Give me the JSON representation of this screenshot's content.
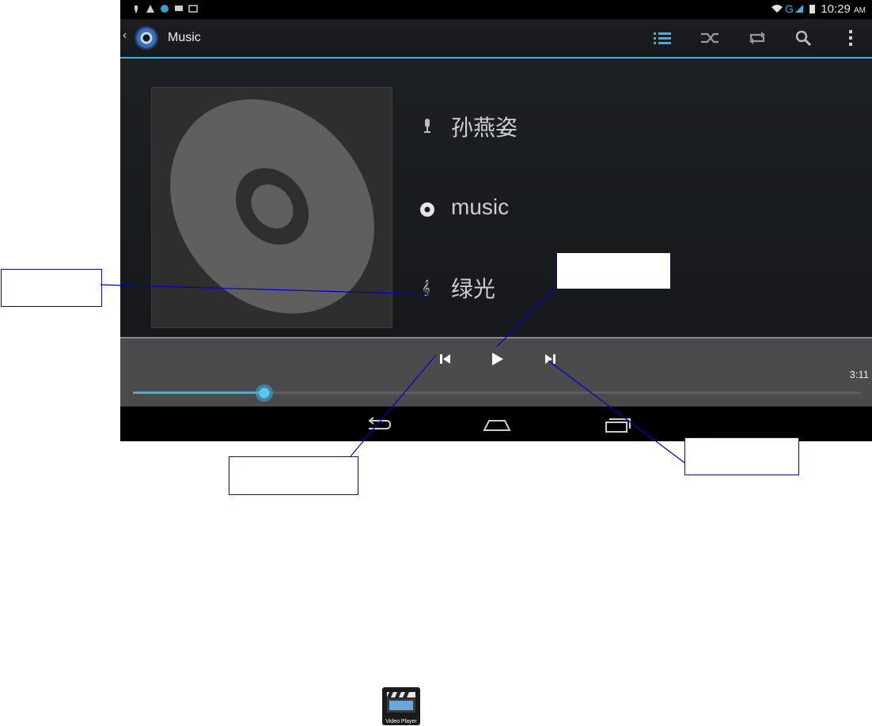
{
  "status_bar": {
    "time": "10:29",
    "ampm": "AM",
    "network": "G"
  },
  "action_bar": {
    "back": "‹",
    "title": "Music",
    "actions": [
      "list-icon",
      "shuffle-icon",
      "repeat-icon",
      "search-icon",
      "overflow-menu-icon"
    ],
    "accent_color": "#33b5e5"
  },
  "track": {
    "artist": "孙燕姿",
    "album": "music",
    "title": "绿光"
  },
  "playback": {
    "duration": "3:11",
    "progress_fraction": 0.18
  },
  "navigation": [
    "back-icon",
    "home-icon",
    "recent-apps-icon"
  ],
  "callouts": [
    "",
    "",
    "",
    ""
  ],
  "video_app": {
    "label": "Video Player"
  }
}
